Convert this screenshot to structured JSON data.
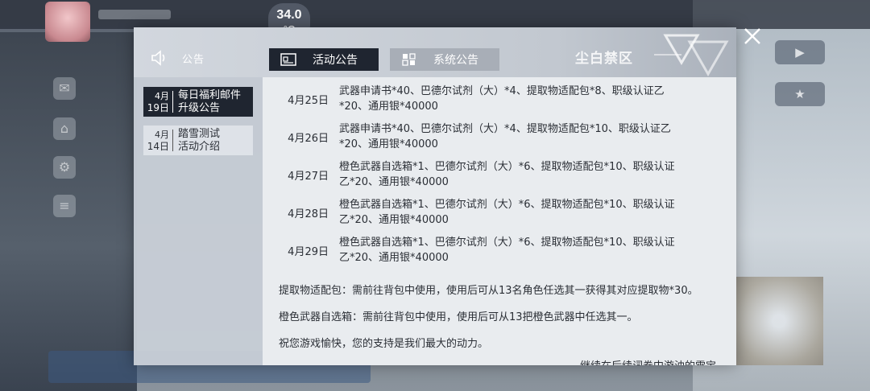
{
  "hud": {
    "temperature_value": "34.0",
    "temperature_unit": "°C"
  },
  "dialog": {
    "header_label": "公告",
    "tabs": [
      {
        "label": "活动公告",
        "active": true
      },
      {
        "label": "系统公告",
        "active": false
      }
    ],
    "brand": "尘白禁区"
  },
  "sidebar": {
    "items": [
      {
        "month": "4月",
        "day": "19日",
        "title_line1": "每日福利邮件",
        "title_line2": "升级公告",
        "active": true
      },
      {
        "month": "4月",
        "day": "14日",
        "title_line1": "踏雪测试",
        "title_line2": "活动介绍",
        "active": false
      }
    ]
  },
  "content": {
    "rewards": [
      {
        "date": "4月25日",
        "line1": "武器申请书*40、巴德尔试剂（大）*4、提取物适配包*8、职级认证乙",
        "line2": "*20、通用银*40000"
      },
      {
        "date": "4月26日",
        "line1": "武器申请书*40、巴德尔试剂（大）*4、提取物适配包*10、职级认证乙",
        "line2": "*20、通用银*40000"
      },
      {
        "date": "4月27日",
        "line1": "橙色武器自选箱*1、巴德尔试剂（大）*6、提取物适配包*10、职级认证",
        "line2": "乙*20、通用银*40000"
      },
      {
        "date": "4月28日",
        "line1": "橙色武器自选箱*1、巴德尔试剂（大）*6、提取物适配包*10、职级认证",
        "line2": "乙*20、通用银*40000"
      },
      {
        "date": "4月29日",
        "line1": "橙色武器自选箱*1、巴德尔试剂（大）*6、提取物适配包*10、职级认证",
        "line2": "乙*20、通用银*40000"
      }
    ],
    "notes": [
      "提取物适配包：需前往背包中使用，使用后可从13名角色任选其一获得其对应提取物*30。",
      "橙色武器自选箱：需前往背包中使用，使用后可从13把橙色武器中任选其一。",
      "祝您游戏愉快，您的支持是我们最大的动力。"
    ],
    "cut_off_text": "继续在后续词卷中游油的雪宝"
  },
  "colors": {
    "active_tab_bg": "#1f2530",
    "inactive_tab_bg": "#a8aeb7",
    "content_bg": "#e9ecef",
    "dialog_bg": "#c8ced6"
  }
}
